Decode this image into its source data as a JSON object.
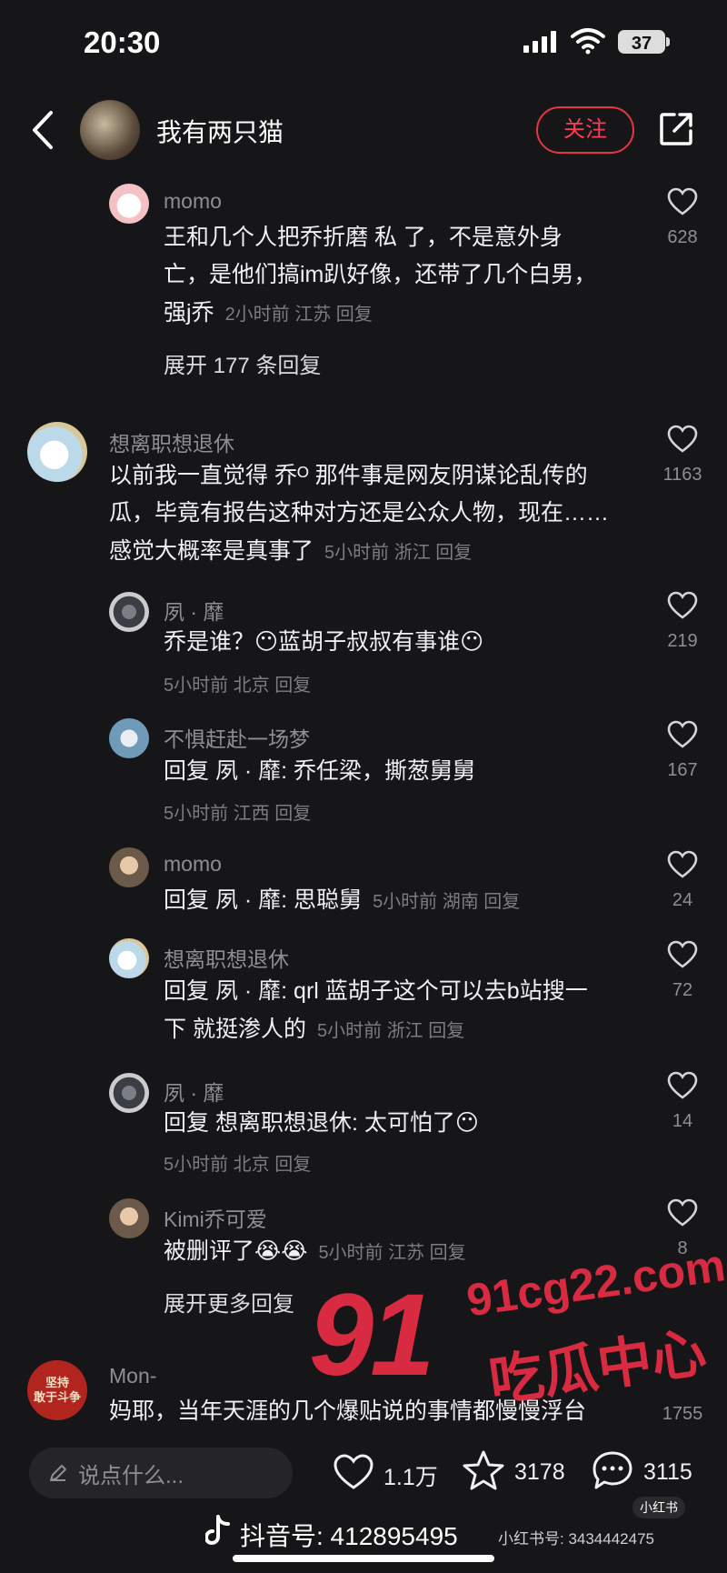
{
  "status_bar": {
    "time": "20:30",
    "battery": "37"
  },
  "header": {
    "username": "我有两只猫",
    "follow_label": "关注"
  },
  "comments": [
    {
      "username": "momo",
      "text_lines": [
        "王和几个人把乔折磨 私 了，不是意外身",
        "亡，是他们搞im趴好像，还带了几个白男，"
      ],
      "last_line": "强j乔",
      "meta": "2小时前 江苏 回复",
      "likes": "628",
      "expand": "展开 177 条回复"
    },
    {
      "username": "想离职想退休",
      "text_lines": [
        "以前我一直觉得 乔ᴼ 那件事是网友阴谋论乱传的",
        "瓜，毕竟有报告这种对方还是公众人物，现在……"
      ],
      "last_line": "感觉大概率是真事了",
      "meta": "5小时前 浙江 回复",
      "likes": "1163"
    }
  ],
  "replies": [
    {
      "username": "夙 · 靡",
      "text": "乔是谁？😶蓝胡子叔叔有事谁😶",
      "meta": "5小时前 北京 回复",
      "likes": "219"
    },
    {
      "username": "不惧赶赴一场梦",
      "text": "回复 夙 · 靡: 乔任梁，撕葱舅舅",
      "meta": "5小时前 江西 回复",
      "likes": "167"
    },
    {
      "username": "momo",
      "text": "回复 夙 · 靡: 思聪舅",
      "meta": "5小时前 湖南 回复",
      "likes": "24"
    },
    {
      "username": "想离职想退休",
      "text": "回复 夙 · 靡: qrl 蓝胡子这个可以去b站搜一",
      "last_line": "下 就挺渗人的",
      "meta": "5小时前 浙江 回复",
      "likes": "72"
    },
    {
      "username": "夙 · 靡",
      "text": "回复 想离职想退休: 太可怕了😶",
      "meta": "5小时前 北京 回复",
      "likes": "14"
    },
    {
      "username": "Kimi乔可爱",
      "text": "被删评了😭😭",
      "meta": "5小时前 江苏 回复",
      "likes": "8"
    }
  ],
  "more_replies": "展开更多回复",
  "partial_comment": {
    "username": "Mon-",
    "avatar_text": [
      "坚持",
      "敢于斗争"
    ],
    "text": "妈耶，当年天涯的几个爆贴说的事情都慢慢浮台",
    "likes": "1755"
  },
  "watermark": {
    "num": "91",
    "url": "91cg22.com",
    "cn": "吃瓜中心"
  },
  "bottom": {
    "input_placeholder": "说点什么...",
    "likes": "1.1万",
    "stars": "3178",
    "comments": "3115",
    "douyin_id": "抖音号: 412895495",
    "xhs_badge": "小红书",
    "xhs_id": "小红书号: 3434442475"
  }
}
